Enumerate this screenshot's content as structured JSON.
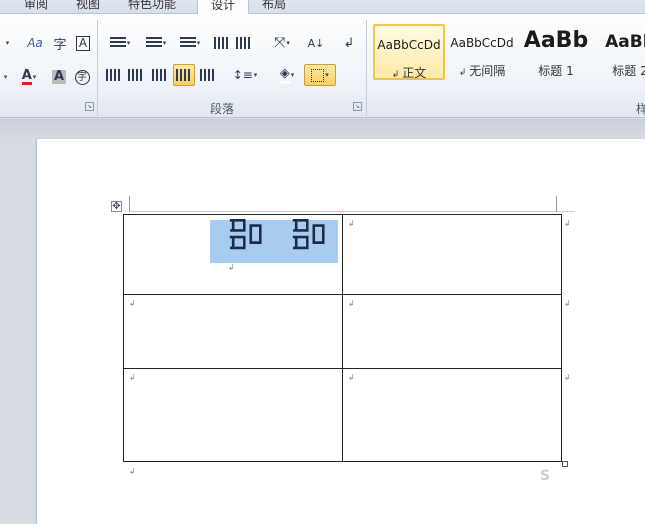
{
  "tabs": [
    "审阅",
    "视图",
    "特色功能",
    "设计",
    "布局"
  ],
  "paragraph_group": {
    "label": "段落"
  },
  "styles": [
    {
      "preview": "AaBbCcDd",
      "name": "正文"
    },
    {
      "preview": "AaBbCcDd",
      "name": "无间隔"
    },
    {
      "preview": "AaBb",
      "name": "标题 1"
    },
    {
      "preview": "AaBb",
      "name": "标题 2"
    }
  ],
  "styles_group": {
    "label": "样"
  },
  "font_buttons": {
    "font_color": "A",
    "char_shading": "A",
    "enclose_char": "字",
    "phonetic": "字",
    "border_char": "A"
  },
  "document": {
    "cell_text": "品"
  },
  "watermark": "S"
}
